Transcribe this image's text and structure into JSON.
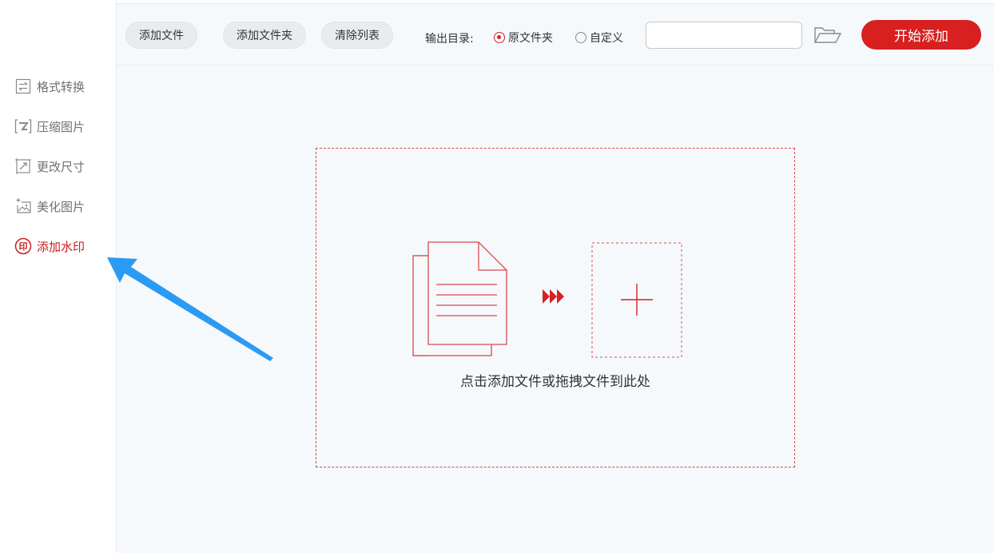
{
  "sidebar": {
    "items": [
      {
        "label": "格式转换",
        "icon": "format-convert-icon"
      },
      {
        "label": "压缩图片",
        "icon": "compress-image-icon"
      },
      {
        "label": "更改尺寸",
        "icon": "resize-icon"
      },
      {
        "label": "美化图片",
        "icon": "beautify-image-icon"
      },
      {
        "label": "添加水印",
        "icon": "watermark-icon",
        "active": true
      }
    ],
    "watermark_icon_glyph": "印"
  },
  "toolbar": {
    "add_file_label": "添加文件",
    "add_folder_label": "添加文件夹",
    "clear_list_label": "清除列表",
    "output_dir_label": "输出目录:",
    "radio_original": "原文件夹",
    "radio_custom": "自定义",
    "path_value": "",
    "start_label": "开始添加"
  },
  "dropzone": {
    "hint": "点击添加文件或拖拽文件到此处"
  },
  "colors": {
    "accent": "#d82020",
    "annotation_arrow": "#2b9af3"
  }
}
